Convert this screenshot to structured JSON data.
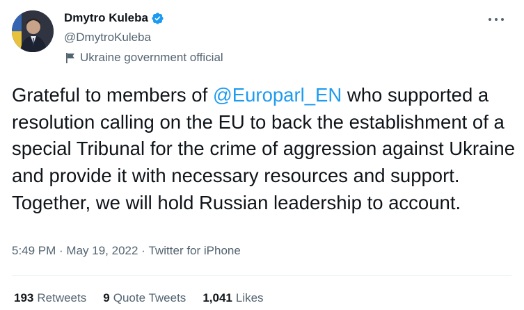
{
  "author": {
    "name": "Dmytro Kuleba",
    "handle": "@DmytroKuleba",
    "label": "Ukraine government official",
    "verified": true,
    "verified_color": "#1d9bf0"
  },
  "tweet": {
    "text_before": "Grateful to members of ",
    "mention": "@Europarl_EN",
    "text_after": " who supported a resolution calling on the EU to back the establishment of a special Tribunal for the crime of aggression against Ukraine and provide it with necessary resources and support. Together, we will hold Russian leadership to account."
  },
  "meta": {
    "time": "5:49 PM",
    "separator": " · ",
    "date": "May 19, 2022",
    "source": "Twitter for iPhone"
  },
  "stats": {
    "retweets_count": "193",
    "retweets_label": "Retweets",
    "quotes_count": "9",
    "quotes_label": "Quote Tweets",
    "likes_count": "1,041",
    "likes_label": "Likes"
  },
  "icons": {
    "more": "more-horizontal-icon",
    "verified": "verified-badge-icon",
    "label": "flag-icon"
  }
}
